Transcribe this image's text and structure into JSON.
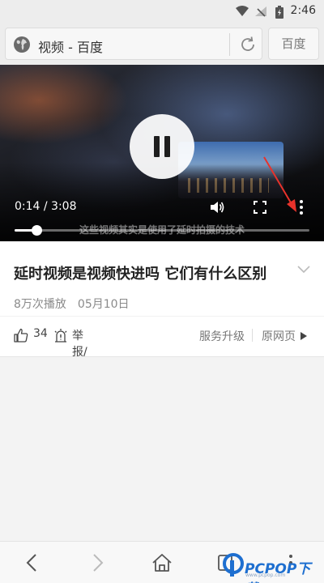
{
  "status_bar": {
    "time": "2:46"
  },
  "address_bar": {
    "page_title": "视频 - 百度",
    "search_engine": "百度"
  },
  "video": {
    "current_time": "0:14",
    "duration": "3:08",
    "time_display": "0:14 / 3:08",
    "progress_fraction": 0.074,
    "subtitle": "这些视频其实是使用了延时拍摄的技术",
    "state": "playing"
  },
  "info": {
    "title": "延时视频是视频快进吗 它们有什么区别",
    "views": "8万次播放",
    "date": "05月10日",
    "like_count": "34",
    "report_label": "举报/反馈",
    "service_label": "服务升级",
    "origin_label": "原网页"
  },
  "watermark": {
    "text": "PCPOP下载",
    "sub": "www.pcpop.com"
  },
  "colors": {
    "accent_red": "#e8322b",
    "watermark_blue": "#1e6fd0"
  }
}
